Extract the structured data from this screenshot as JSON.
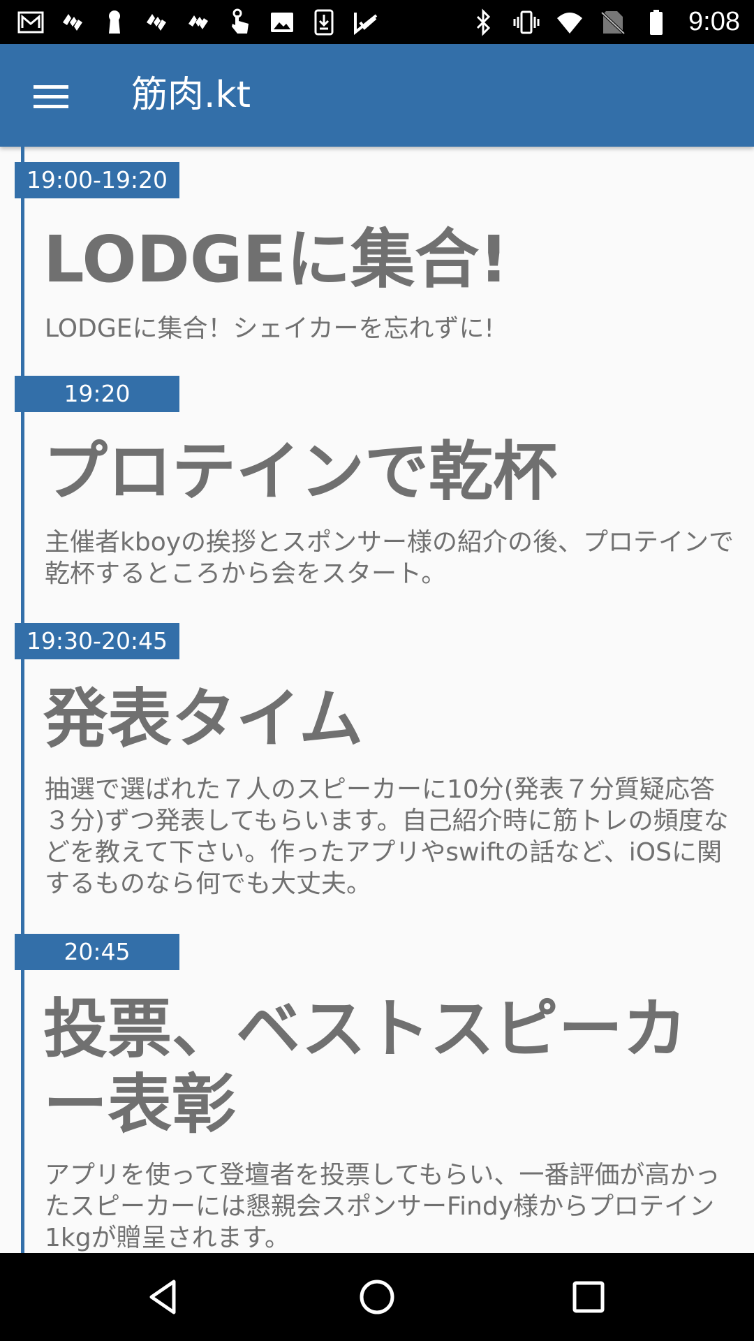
{
  "status_bar": {
    "time": "9:08",
    "left_icons": [
      "gmail-icon",
      "app-notification-icon",
      "keyhole-icon",
      "app-notification-icon",
      "app-notification-icon",
      "touch-icon",
      "image-icon",
      "download-icon",
      "check-app-icon"
    ],
    "right_icons": [
      "bluetooth-icon",
      "vibrate-icon",
      "wifi-icon",
      "no-sim-icon",
      "battery-icon"
    ]
  },
  "app_bar": {
    "title": "筋肉.kt",
    "menu_icon": "hamburger-menu-icon",
    "color": "#336fa9"
  },
  "events": [
    {
      "time": "19:00-19:20",
      "title": "LODGEに集合!",
      "description": "LODGEに集合！シェイカーを忘れずに!"
    },
    {
      "time": "19:20",
      "title": "プロテインで乾杯",
      "description": "主催者kboyの挨拶とスポンサー様の紹介の後、プロテインで乾杯するところから会をスタート。"
    },
    {
      "time": "19:30-20:45",
      "title": "発表タイム",
      "description": "抽選で選ばれた７人のスピーカーに10分(発表７分質疑応答３分)ずつ発表してもらいます。自己紹介時に筋トレの頻度などを教えて下さい。作ったアプリやswiftの話など、iOSに関するものなら何でも大丈夫。"
    },
    {
      "time": "20:45",
      "title": "投票、ベストスピーカー表彰",
      "description": "アプリを使って登壇者を投票してもらい、一番評価が高かったスピーカーには懇親会スポンサーFindy様からプロテイン1kgが贈呈されます。"
    }
  ],
  "nav_bar": {
    "back_icon": "back-triangle-icon",
    "home_icon": "home-circle-icon",
    "recents_icon": "recents-square-icon"
  }
}
